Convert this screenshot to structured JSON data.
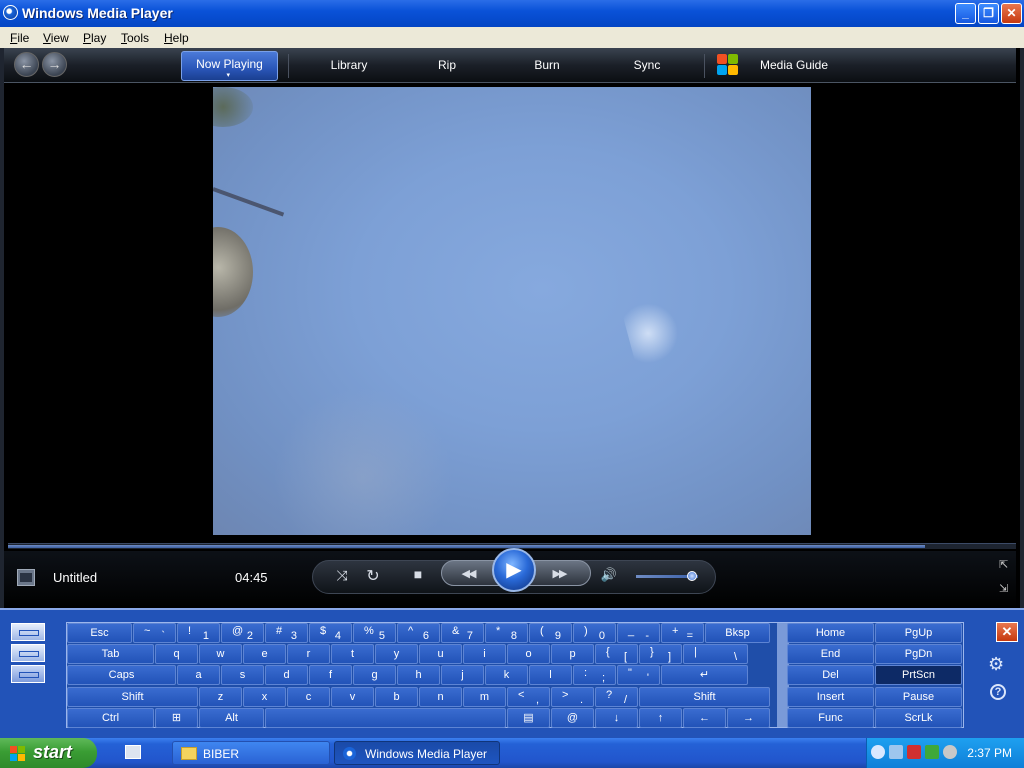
{
  "window": {
    "title": "Windows Media Player",
    "minimize": "_",
    "maximize": "❐",
    "close": "✕"
  },
  "menubar": [
    {
      "label": "File",
      "hotkey": "F",
      "rest": "ile"
    },
    {
      "label": "View",
      "hotkey": "V",
      "rest": "iew"
    },
    {
      "label": "Play",
      "hotkey": "P",
      "rest": "lay"
    },
    {
      "label": "Tools",
      "hotkey": "T",
      "rest": "ools"
    },
    {
      "label": "Help",
      "hotkey": "H",
      "rest": "elp"
    }
  ],
  "nav": {
    "back": "←",
    "forward": "→",
    "tabs": [
      "Now Playing",
      "Library",
      "Rip",
      "Burn",
      "Sync",
      "Media Guide"
    ],
    "active_tab": "Now Playing",
    "caret": "▾"
  },
  "player": {
    "track_title": "Untitled",
    "elapsed": "04:45",
    "seek_progress": 0.91,
    "volume": 0.9,
    "buttons": {
      "shuffle": "⤨",
      "repeat": "↻",
      "stop": "■",
      "prev": "◀◀",
      "play": "▶",
      "next": "▶▶",
      "mute": "🔊"
    },
    "corner_top": "⇱",
    "corner_bottom": "⇲"
  },
  "keyboard": {
    "row1": [
      {
        "label": "Esc"
      },
      {
        "shift": "~",
        "base": "`"
      },
      {
        "shift": "!",
        "base": "1"
      },
      {
        "shift": "@",
        "base": "2"
      },
      {
        "shift": "#",
        "base": "3"
      },
      {
        "shift": "$",
        "base": "4"
      },
      {
        "shift": "%",
        "base": "5"
      },
      {
        "shift": "^",
        "base": "6"
      },
      {
        "shift": "&",
        "base": "7"
      },
      {
        "shift": "*",
        "base": "8"
      },
      {
        "shift": "(",
        "base": "9"
      },
      {
        "shift": ")",
        "base": "0"
      },
      {
        "shift": "_",
        "base": "-"
      },
      {
        "shift": "+",
        "base": "="
      },
      {
        "label": "Bksp"
      }
    ],
    "row2": [
      {
        "label": "Tab"
      },
      {
        "label": "q"
      },
      {
        "label": "w"
      },
      {
        "label": "e"
      },
      {
        "label": "r"
      },
      {
        "label": "t"
      },
      {
        "label": "y"
      },
      {
        "label": "u"
      },
      {
        "label": "i"
      },
      {
        "label": "o"
      },
      {
        "label": "p"
      },
      {
        "shift": "{",
        "base": "["
      },
      {
        "shift": "}",
        "base": "]"
      },
      {
        "shift": "|",
        "base": "\\"
      }
    ],
    "row3": [
      {
        "label": "Caps"
      },
      {
        "label": "a"
      },
      {
        "label": "s"
      },
      {
        "label": "d"
      },
      {
        "label": "f"
      },
      {
        "label": "g"
      },
      {
        "label": "h"
      },
      {
        "label": "j"
      },
      {
        "label": "k"
      },
      {
        "label": "l"
      },
      {
        "shift": ":",
        "base": ";"
      },
      {
        "shift": "\"",
        "base": "'"
      },
      {
        "label": "↵"
      }
    ],
    "row4": [
      {
        "label": "Shift"
      },
      {
        "label": "z"
      },
      {
        "label": "x"
      },
      {
        "label": "c"
      },
      {
        "label": "v"
      },
      {
        "label": "b"
      },
      {
        "label": "n"
      },
      {
        "label": "m"
      },
      {
        "shift": "<",
        "base": ","
      },
      {
        "shift": ">",
        "base": "."
      },
      {
        "shift": "?",
        "base": "/"
      },
      {
        "label": "Shift"
      }
    ],
    "row5": [
      {
        "label": "Ctrl"
      },
      {
        "label": "⊞"
      },
      {
        "label": "Alt"
      },
      {
        "label": ""
      },
      {
        "label": "▤"
      },
      {
        "label": "@"
      },
      {
        "label": "↓"
      },
      {
        "label": "↑"
      },
      {
        "label": "←"
      },
      {
        "label": "→"
      }
    ],
    "nav_keys": [
      [
        "Home",
        "PgUp"
      ],
      [
        "End",
        "PgDn"
      ],
      [
        "Del",
        "PrtScn"
      ],
      [
        "Insert",
        "Pause"
      ],
      [
        "Func",
        "ScrLk"
      ]
    ],
    "close": "✕",
    "settings_icon": "⚙",
    "help_icon": "?"
  },
  "taskbar": {
    "start": "start",
    "items": [
      {
        "label": "BIBER",
        "active": false
      },
      {
        "label": "Windows Media Player",
        "active": true
      }
    ],
    "clock": "2:37 PM"
  }
}
